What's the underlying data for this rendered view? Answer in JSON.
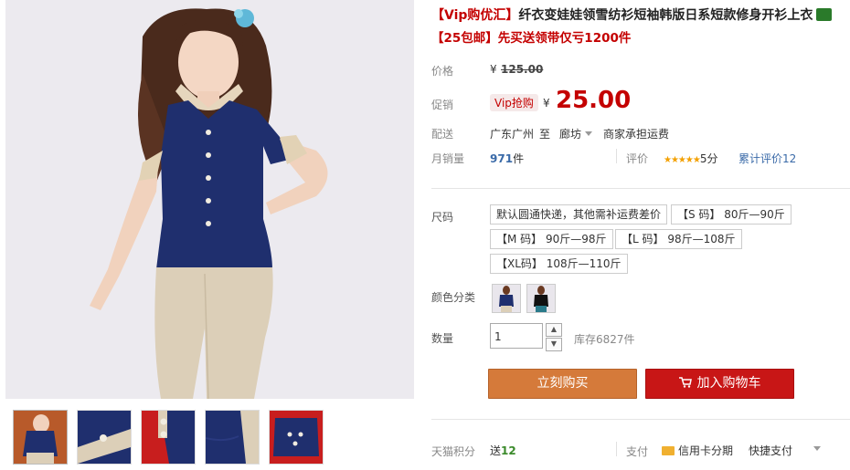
{
  "product": {
    "title_tag": "【Vip购优汇】",
    "title_text": "纤衣变娃娃领雪纺衫短袖韩版日系短款修身开衫上衣",
    "subtitle_tag": "【25包邮】",
    "subtitle_text": "先买送领带仅亏1200件"
  },
  "price": {
    "label": "价格",
    "yen": "¥",
    "original": "125.00",
    "promo_label": "促销",
    "vip_badge": "Vip抢购",
    "promo_price": "25.00"
  },
  "shipping": {
    "label": "配送",
    "from": "广东广州",
    "to_word": "至",
    "to": "廊坊",
    "fee": "商家承担运费"
  },
  "sales": {
    "label": "月销量",
    "count": "971",
    "unit": "件",
    "rating_label": "评价",
    "stars": "★★★★★",
    "score": "5分",
    "reviews": "累计评价12"
  },
  "size": {
    "label": "尺码",
    "options": [
      "默认圆通快递，其他需补运费差价",
      "【S 码】 80斤—90斤",
      "【M 码】 90斤—98斤",
      "【L 码】 98斤—108斤",
      "【XL码】 108斤—110斤"
    ]
  },
  "color": {
    "label": "颜色分类"
  },
  "quantity": {
    "label": "数量",
    "value": "1",
    "up": "▲",
    "down": "▼",
    "stock": "库存6827件"
  },
  "actions": {
    "buy": "立刻购买",
    "cart": "加入购物车"
  },
  "footer": {
    "points_label": "天猫积分",
    "points_prefix": "送",
    "points_value": "12",
    "pay_label": "支付",
    "credit": "信用卡分期",
    "quick": "快捷支付"
  },
  "colors": {
    "accent": "#c40000",
    "navy": "#1f2f6e",
    "khaki": "#dccfb8",
    "buy_button": "#d57a3a",
    "cart_button": "#c81616"
  }
}
